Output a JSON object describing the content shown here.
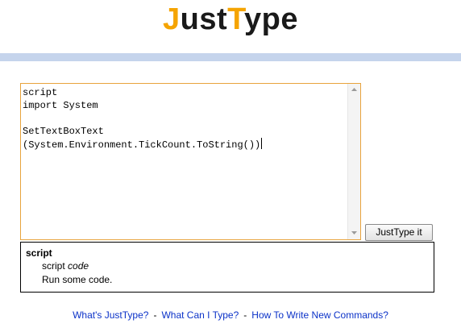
{
  "logo": {
    "part1": "J",
    "part2": "ust",
    "part3": "T",
    "part4": "ype",
    "accent_color": "#f5a400",
    "dark_color": "#1a1a1a"
  },
  "band_color": "#c5d4ec",
  "editor": {
    "lines": [
      "script",
      "import System",
      "",
      "SetTextBoxText",
      "(System.Environment.TickCount.ToString())"
    ],
    "border_color": "#e8a33c"
  },
  "button": {
    "label": "JustType it"
  },
  "help": {
    "title": "script",
    "usage_command": "script",
    "usage_arg": "code",
    "description": "Run some code."
  },
  "footer": {
    "links": [
      "What's JustType?",
      "What Can I Type?",
      "How To Write New Commands?"
    ],
    "separator": "-",
    "link_color": "#0b32c8"
  },
  "icons": {
    "scroll_up": "chevron-up-icon",
    "scroll_down": "chevron-down-icon"
  }
}
